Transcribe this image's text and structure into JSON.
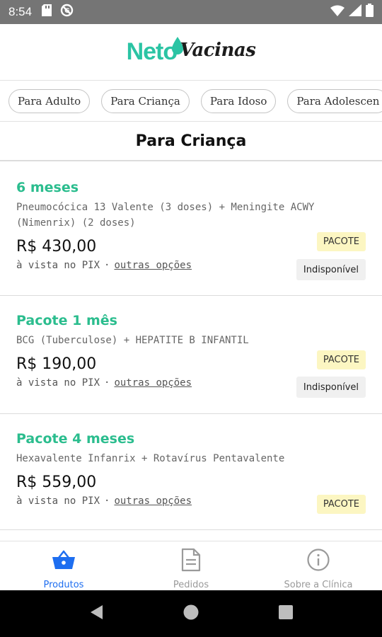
{
  "status_bar": {
    "time": "8:54",
    "left_icons": [
      "sd-card-icon",
      "blocked-icon"
    ],
    "right_icons": [
      "wifi-icon",
      "signal-icon",
      "battery-icon"
    ]
  },
  "header": {
    "logo_primary": "Neto",
    "logo_secondary": "Vacinas",
    "brand_color": "#2bc4a4"
  },
  "filters": [
    {
      "label": "Para Adulto"
    },
    {
      "label": "Para Criança"
    },
    {
      "label": "Para Idoso"
    },
    {
      "label": "Para Adolescen"
    }
  ],
  "section": {
    "title": "Para Criança"
  },
  "products": [
    {
      "name": "6 meses",
      "description": "Pneumocócica 13 Valente (3 doses) + Meningite ACWY (Nimenrix) (2 doses)",
      "price": "R$ 430,00",
      "payment": "à vista no PIX",
      "separator": "·",
      "other_options": "outras opções",
      "badge": "PACOTE",
      "status": "Indisponível"
    },
    {
      "name": "Pacote 1 mês",
      "description": "BCG (Tuberculose) + HEPATITE B INFANTIL",
      "price": "R$ 190,00",
      "payment": "à vista no PIX",
      "separator": "·",
      "other_options": "outras opções",
      "badge": "PACOTE",
      "status": "Indisponível"
    },
    {
      "name": "Pacote 4 meses",
      "description": "Hexavalente Infanrix + Rotavírus Pentavalente",
      "price": "R$ 559,00",
      "payment": "à vista no PIX",
      "separator": "·",
      "other_options": "outras opções",
      "badge": "PACOTE"
    }
  ],
  "bottom_nav": [
    {
      "label": "Produtos",
      "icon": "basket-icon",
      "active": true
    },
    {
      "label": "Pedidos",
      "icon": "document-icon",
      "active": false
    },
    {
      "label": "Sobre a Clínica",
      "icon": "info-icon",
      "active": false
    }
  ],
  "colors": {
    "product_name": "#2bbd8e",
    "nav_active": "#1e6ef0",
    "badge_bg": "#fcf6c2"
  },
  "android_nav": [
    "back-icon",
    "home-icon",
    "recents-icon"
  ]
}
